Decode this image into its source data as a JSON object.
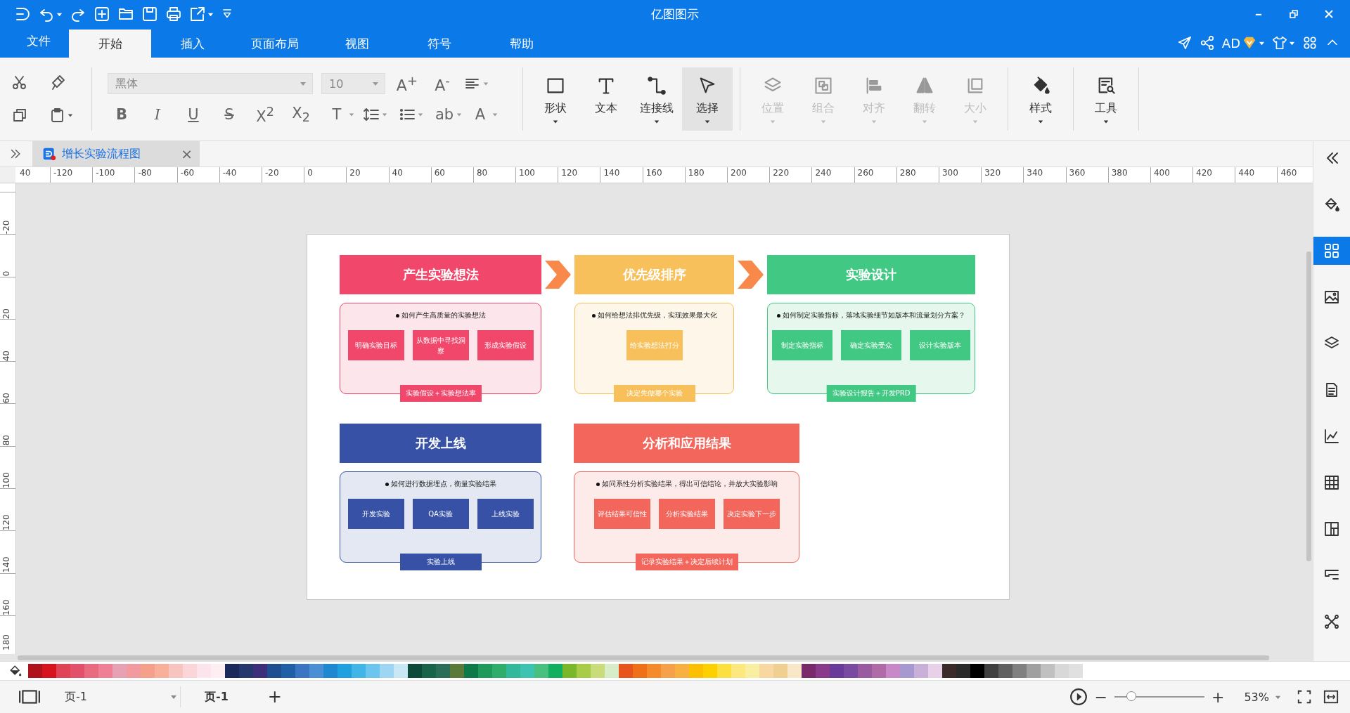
{
  "window": {
    "title": "亿图图示"
  },
  "menu_tabs": [
    {
      "label": "文件",
      "selected": false
    },
    {
      "label": "开始",
      "selected": true
    },
    {
      "label": "插入",
      "selected": false
    },
    {
      "label": "页面布局",
      "selected": false
    },
    {
      "label": "视图",
      "selected": false
    },
    {
      "label": "符号",
      "selected": false
    },
    {
      "label": "帮助",
      "selected": false
    }
  ],
  "account": {
    "user": "AD"
  },
  "ribbon": {
    "font": {
      "family": "黑体",
      "size": "10"
    },
    "size_buttons": [
      {
        "label": "A$^{+}$"
      },
      {
        "label": "A$^{-}$"
      }
    ],
    "format_buttons": [
      {
        "kind": "bold",
        "label": "B",
        "dropdown": false
      },
      {
        "kind": "italic",
        "label": "I",
        "dropdown": false
      },
      {
        "kind": "underline",
        "label": "U",
        "dropdown": false
      },
      {
        "kind": "strike",
        "label": "S",
        "dropdown": false
      },
      {
        "kind": "plain",
        "label": "X$^{2}$",
        "dropdown": false
      },
      {
        "kind": "plain",
        "label": "X$_{2}$",
        "dropdown": false
      },
      {
        "kind": "plain",
        "label": "T",
        "dropdown": true
      },
      {
        "kind": "linespacing",
        "dropdown": true
      },
      {
        "kind": "bullets",
        "dropdown": true
      },
      {
        "kind": "plain",
        "label": "ab",
        "dropdown": true
      },
      {
        "kind": "plain",
        "label": "A",
        "dropdown": true
      }
    ],
    "tool_groups": [
      {
        "tools": [
          {
            "kind": "shape",
            "label": "形状",
            "disabled": false,
            "selected": false,
            "dropdown": true
          },
          {
            "kind": "text",
            "label": "文本",
            "disabled": false,
            "selected": false,
            "dropdown": false
          },
          {
            "kind": "connector",
            "label": "连接线",
            "disabled": false,
            "selected": false,
            "dropdown": true
          },
          {
            "kind": "select",
            "label": "选择",
            "disabled": false,
            "selected": true,
            "dropdown": true
          }
        ]
      },
      {
        "tools": [
          {
            "kind": "position",
            "label": "位置",
            "disabled": true,
            "selected": false,
            "dropdown": true
          },
          {
            "kind": "group",
            "label": "组合",
            "disabled": true,
            "selected": false,
            "dropdown": true
          },
          {
            "kind": "align",
            "label": "对齐",
            "disabled": true,
            "selected": false,
            "dropdown": true
          },
          {
            "kind": "flip",
            "label": "翻转",
            "disabled": true,
            "selected": false,
            "dropdown": true
          },
          {
            "kind": "size",
            "label": "大小",
            "disabled": true,
            "selected": false,
            "dropdown": true
          }
        ]
      },
      {
        "tools": [
          {
            "kind": "style",
            "label": "样式",
            "disabled": false,
            "selected": false,
            "dropdown": true
          }
        ]
      },
      {
        "tools": [
          {
            "kind": "tools",
            "label": "工具",
            "disabled": false,
            "selected": false,
            "dropdown": true
          }
        ]
      }
    ]
  },
  "document_tab": {
    "title": "增长实验流程图",
    "close": "×"
  },
  "ruler": {
    "horizontal": [
      "40",
      "-120",
      "-100",
      "-80",
      "-60",
      "-40",
      "-20",
      "0",
      "20",
      "40",
      "60",
      "80",
      "100",
      "120",
      "140",
      "160",
      "180",
      "200",
      "220",
      "240",
      "260",
      "280",
      "300",
      "320",
      "340",
      "360",
      "380",
      "400",
      "420",
      "440",
      "460"
    ],
    "vertical": [
      "-20",
      "0",
      "20",
      "40",
      "60",
      "80",
      "100",
      "120",
      "140",
      "160",
      "180"
    ]
  },
  "diagram": {
    "rows": [
      {
        "connected": true,
        "stages": [
          {
            "title": "产生实验想法",
            "color": "#f0476b",
            "question": "如何产生高质量的实验想法",
            "steps": [
              "明确实验目标",
              "从数据中寻找洞察",
              "形成实验假设"
            ],
            "output": "实验假设＋实验想法率"
          },
          {
            "title": "优先级排序",
            "color": "#f7c05a",
            "question": "如何给想法排优先级，实现效果最大化",
            "steps": [
              "给实验想法打分"
            ],
            "output": "决定先做哪个实验"
          },
          {
            "title": "实验设计",
            "color": "#41c882",
            "question": "如何制定实验指标，落地实验细节如版本和流量划分方案？",
            "steps": [
              "制定实验指标",
              "确定实验受众",
              "设计实验版本"
            ],
            "output": "实验设计报告＋开发PRD"
          }
        ]
      },
      {
        "connected": false,
        "stages": [
          {
            "title": "开发上线",
            "color": "#3651a5",
            "question": "如何进行数据埋点，衡量实验结果",
            "steps": [
              "开发实验",
              "QA实验",
              "上线实验"
            ],
            "output": "实验上线"
          },
          {
            "title": "分析和应用结果",
            "color": "#f2665c",
            "question": "如问系性分析实验结果，得出可信结论，并放大实验影响",
            "steps": [
              "评估结果可信性",
              "分析实验结果",
              "决定实验下一步"
            ],
            "output": "记录实验结果＋决定后续计划"
          }
        ]
      }
    ]
  },
  "sidebar": {
    "items": [
      {
        "kind": "collapse",
        "selected": false
      },
      {
        "kind": "fill",
        "selected": false
      },
      {
        "kind": "grid",
        "selected": true
      },
      {
        "kind": "image",
        "selected": false
      },
      {
        "kind": "layers",
        "selected": false
      },
      {
        "kind": "page",
        "selected": false
      },
      {
        "kind": "chart",
        "selected": false
      },
      {
        "kind": "table",
        "selected": false
      },
      {
        "kind": "layout",
        "selected": false
      },
      {
        "kind": "format",
        "selected": false
      },
      {
        "kind": "network",
        "selected": false
      }
    ]
  },
  "palette": [
    {
      "color": "#b0121b"
    },
    {
      "color": "#d7141e"
    },
    {
      "color": "#e04356"
    },
    {
      "color": "#e3506a"
    },
    {
      "color": "#ea6a80"
    },
    {
      "color": "#ee7f97"
    },
    {
      "color": "#e8a0b4"
    },
    {
      "color": "#f19aa0"
    },
    {
      "color": "#f4a08a"
    },
    {
      "color": "#f8b09a"
    },
    {
      "color": "#f8c4c0"
    },
    {
      "color": "#fbd5d8"
    },
    {
      "color": "#fce4ec"
    },
    {
      "color": "#fdeef2"
    },
    {
      "color": "#1b2a5a"
    },
    {
      "color": "#24386e"
    },
    {
      "color": "#3c2e7a"
    },
    {
      "color": "#1d4f91"
    },
    {
      "color": "#1f5fa8"
    },
    {
      "color": "#3a75c4"
    },
    {
      "color": "#4a8fd6"
    },
    {
      "color": "#1e88d0"
    },
    {
      "color": "#1fa1e0"
    },
    {
      "color": "#41b4e8"
    },
    {
      "color": "#6cc5ee"
    },
    {
      "color": "#9dd6f2"
    },
    {
      "color": "#c8e8f6"
    },
    {
      "color": "#0e4a3a"
    },
    {
      "color": "#17644a"
    },
    {
      "color": "#2a6e5a"
    },
    {
      "color": "#5a7a3a"
    },
    {
      "color": "#0e7a4a"
    },
    {
      "color": "#1f9a5a"
    },
    {
      "color": "#2eae6a"
    },
    {
      "color": "#32b89a"
    },
    {
      "color": "#3cc4b0"
    },
    {
      "color": "#48c080"
    },
    {
      "color": "#10b060"
    },
    {
      "color": "#7ab82a"
    },
    {
      "color": "#a8cc48"
    },
    {
      "color": "#c8dc7a"
    },
    {
      "color": "#d8ecc8"
    },
    {
      "color": "#e8541e"
    },
    {
      "color": "#f07018"
    },
    {
      "color": "#f48a2a"
    },
    {
      "color": "#f6a04a"
    },
    {
      "color": "#f8b040"
    },
    {
      "color": "#fcc000"
    },
    {
      "color": "#fdd000"
    },
    {
      "color": "#fce040"
    },
    {
      "color": "#fde880"
    },
    {
      "color": "#f8f0a0"
    },
    {
      "color": "#f8d8a0"
    },
    {
      "color": "#f0d090"
    },
    {
      "color": "#f8e8c8"
    },
    {
      "color": "#7a2a6a"
    },
    {
      "color": "#8a3a8a"
    },
    {
      "color": "#6a3a9a"
    },
    {
      "color": "#7a4aa0"
    },
    {
      "color": "#9a5aa0"
    },
    {
      "color": "#b06aa8"
    },
    {
      "color": "#c888c8"
    },
    {
      "color": "#a898d0"
    },
    {
      "color": "#c8b0d8"
    },
    {
      "color": "#e8d0e8"
    },
    {
      "color": "#3a2a2a"
    },
    {
      "color": "#2a2a2a"
    },
    {
      "color": "#000000"
    },
    {
      "color": "#404040"
    },
    {
      "color": "#606060"
    },
    {
      "color": "#808080"
    },
    {
      "color": "#a0a0a0"
    },
    {
      "color": "#c0c0c0"
    },
    {
      "color": "#d8d8d8"
    },
    {
      "color": "#e0e0e0"
    }
  ],
  "status_bar": {
    "page_selector": "页-1",
    "pages": [
      {
        "label": "页-1",
        "selected": true
      }
    ],
    "add_page": "+",
    "zoom_out": "−",
    "zoom_in": "+",
    "level": 0.19,
    "zoom": "53%"
  }
}
